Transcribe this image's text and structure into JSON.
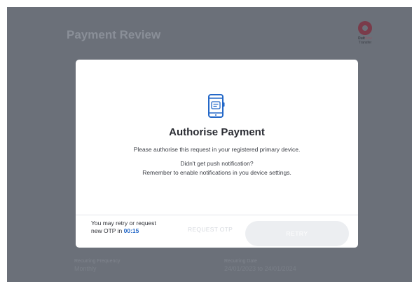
{
  "page": {
    "title": "Payment Review"
  },
  "logo": {
    "brand_bold": "Duit",
    "brand_accent": "Now",
    "brand_sub": "Transfer"
  },
  "background_fields": {
    "frequency_label": "Recurring Frequency",
    "frequency_value": "Monthly",
    "date_label": "Recurring Date",
    "date_value": "24/01/2023 to 24/01/2024"
  },
  "modal": {
    "title": "Authorise Payment",
    "instruction": "Please authorise this request in your registered primary device.",
    "push_question": "Didn't get push notification?",
    "push_hint": "Remember to enable notifications in you device settings.",
    "retry_note_line1": "You may retry or request",
    "retry_note_line2_prefix": "new OTP in",
    "timer": "00:15",
    "request_otp_label": "REQUEST OTP",
    "retry_label": "RETRY"
  },
  "colors": {
    "overlay": "#6b7079",
    "accent_blue": "#2468c8",
    "modal_bg": "#ffffff"
  },
  "icons": {
    "device": "smartphone-icon",
    "logo": "duitnow-logo-icon"
  }
}
